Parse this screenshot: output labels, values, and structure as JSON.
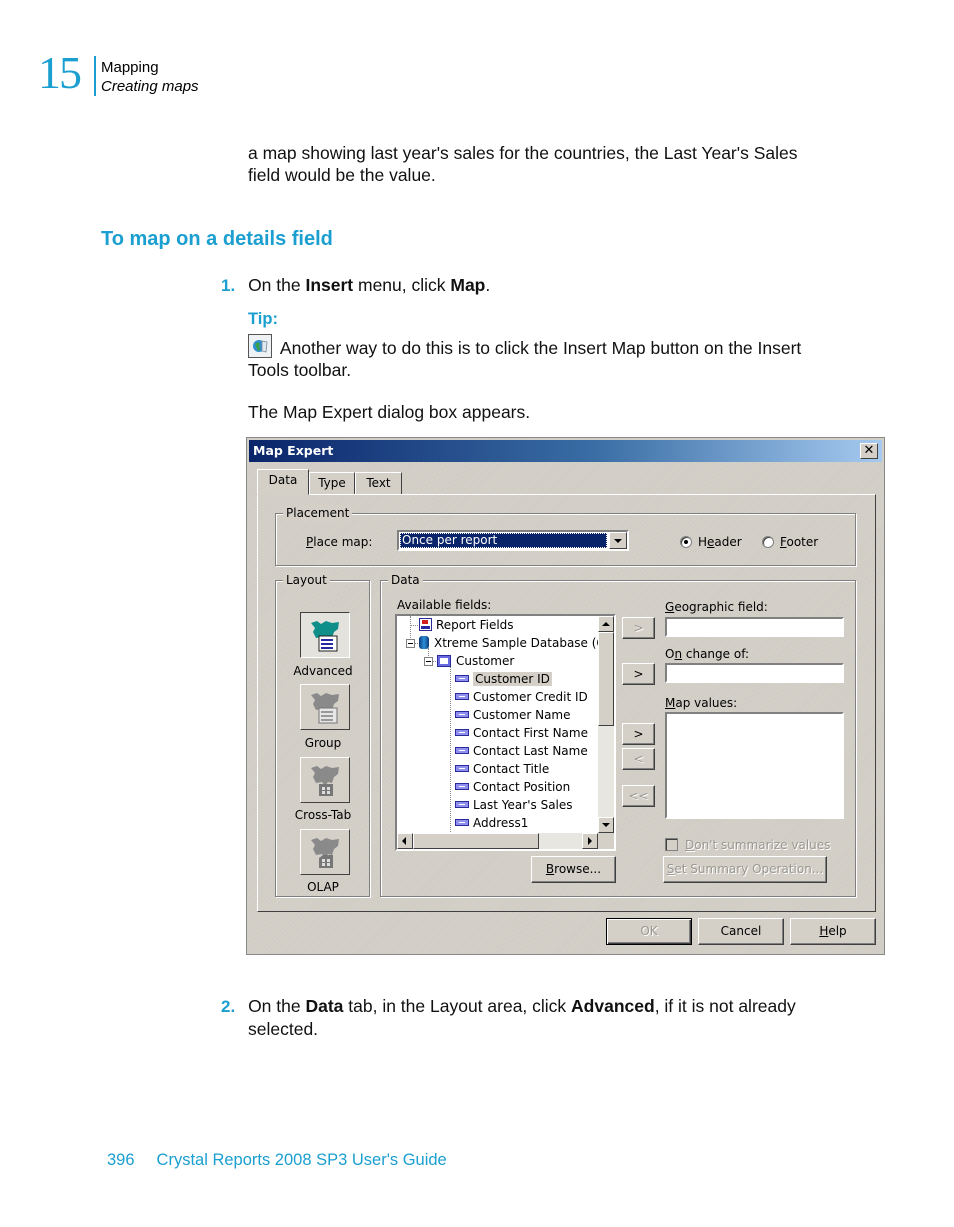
{
  "header": {
    "chapter_number": "15",
    "chapter_title": "Mapping",
    "section_title": "Creating maps"
  },
  "intro_text": "a map showing last year's sales for the countries, the Last Year's Sales field would be the value.",
  "intro_lines": [
    "a map showing last year's sales for the countries, the Last Year's Sales",
    "field would be the value."
  ],
  "procedure_heading": "To map on a details field",
  "step1": {
    "number": "1.",
    "pre": "On the ",
    "bold1": "Insert",
    "mid": " menu, click ",
    "bold2": "Map",
    "post": "."
  },
  "tip": {
    "label": "Tip:",
    "icon": "insert-map-icon",
    "line1": " Another way to do this is to click the Insert Map button on the Insert",
    "line2": "Tools toolbar."
  },
  "dialog_appears_text": "The Map Expert dialog box appears.",
  "dialog": {
    "title": "Map Expert",
    "close_icon": "close-icon",
    "tabs": [
      {
        "label": "Data",
        "active": true
      },
      {
        "label": "Type",
        "active": false
      },
      {
        "label": "Text",
        "active": false
      }
    ],
    "placement": {
      "group_label": "Placement",
      "place_map_label": "Place map:",
      "place_map_accel": "P",
      "place_map_rest": "lace map:",
      "place_map_value": "Once per report",
      "radio_header": {
        "accel_pre": "H",
        "accel": "e",
        "rest": "ader",
        "label": "Header",
        "checked": true
      },
      "radio_footer": {
        "accel": "F",
        "rest": "ooter",
        "label": "Footer",
        "checked": false
      }
    },
    "layout": {
      "group_label": "Layout",
      "options": [
        {
          "label": "Advanced",
          "selected": true,
          "icon": "advanced-map-icon"
        },
        {
          "label": "Group",
          "selected": false,
          "icon": "group-map-icon"
        },
        {
          "label": "Cross-Tab",
          "selected": false,
          "icon": "crosstab-map-icon"
        },
        {
          "label": "OLAP",
          "selected": false,
          "icon": "olap-map-icon"
        }
      ]
    },
    "data": {
      "group_label": "Data",
      "available_fields_label": "Available fields:",
      "tree": [
        {
          "label": "Report Fields",
          "level": 0,
          "icon": "report-fields-icon"
        },
        {
          "label": "Xtreme Sample Database (OD",
          "level": 0,
          "icon": "database-icon",
          "expanded": true
        },
        {
          "label": "Customer",
          "level": 1,
          "icon": "table-icon",
          "expanded": true
        },
        {
          "label": "Customer ID",
          "level": 2,
          "icon": "field-icon",
          "highlighted": true
        },
        {
          "label": "Customer Credit ID",
          "level": 2,
          "icon": "field-icon"
        },
        {
          "label": "Customer Name",
          "level": 2,
          "icon": "field-icon"
        },
        {
          "label": "Contact First Name",
          "level": 2,
          "icon": "field-icon"
        },
        {
          "label": "Contact Last Name",
          "level": 2,
          "icon": "field-icon"
        },
        {
          "label": "Contact Title",
          "level": 2,
          "icon": "field-icon"
        },
        {
          "label": "Contact Position",
          "level": 2,
          "icon": "field-icon"
        },
        {
          "label": "Last Year's Sales",
          "level": 2,
          "icon": "field-icon"
        },
        {
          "label": "Address1",
          "level": 2,
          "icon": "field-icon"
        }
      ],
      "browse_button": "Browse...",
      "browse_accel": "B",
      "browse_rest": "rowse...",
      "geographic_field": {
        "accel": "G",
        "rest": "eographic field:",
        "label": "Geographic field:",
        "value": ""
      },
      "on_change_of": {
        "pre": "O",
        "accel": "n",
        "rest": " change of:",
        "label": "On change of:",
        "value": ""
      },
      "map_values": {
        "accel": "M",
        "rest": "ap values:",
        "label": "Map values:",
        "items": []
      },
      "arrow_buttons": {
        "add_geographic": ">",
        "add_on_change": ">",
        "add_value": ">",
        "remove_value": "<",
        "remove_all_values": "<<"
      },
      "dont_summarize": {
        "accel": "D",
        "rest": "on't summarize values",
        "label": "Don't summarize values",
        "checked": false,
        "enabled": false
      },
      "set_summary": {
        "accel": "S",
        "rest": "et Summary Operation...",
        "label": "Set Summary Operation...",
        "enabled": false
      }
    },
    "buttons": {
      "ok": "OK",
      "cancel": "Cancel",
      "help_accel": "H",
      "help_rest": "elp",
      "help": "Help"
    }
  },
  "step2": {
    "number": "2.",
    "pre": "On the ",
    "bold1": "Data",
    "mid": " tab, in the Layout area, click ",
    "bold2": "Advanced",
    "post": ", if it is not already",
    "line2": "selected."
  },
  "footer": {
    "page_number": "396",
    "book_title": "Crystal Reports 2008 SP3 User's Guide"
  }
}
